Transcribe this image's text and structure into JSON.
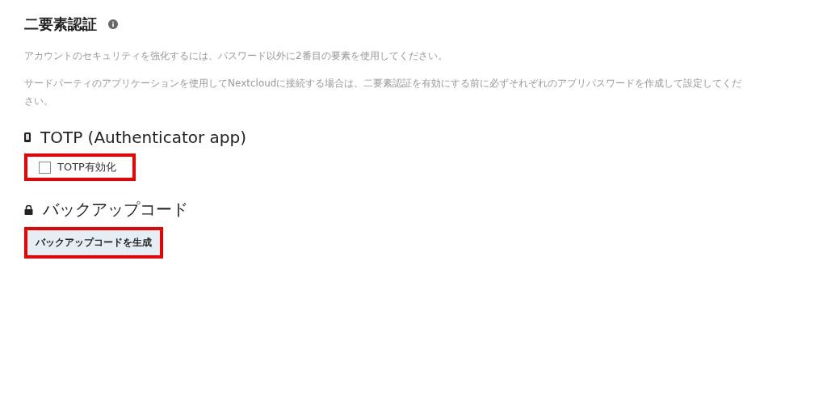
{
  "title": "二要素認証",
  "paragraphs": [
    "アカウントのセキュリティを強化するには、パスワード以外に2番目の要素を使用してください。",
    "サードパーティのアプリケーションを使用してNextcloudに接続する場合は、二要素認証を有効にする前に必ずそれぞれのアプリパスワードを作成して設定してください。"
  ],
  "sections": [
    {
      "kind": "checkbox",
      "heading": "TOTP (Authenticator app)",
      "label": "TOTP有効化",
      "checked": false,
      "highlighted": true
    },
    {
      "kind": "button",
      "heading": "バックアップコード",
      "label": "バックアップコードを生成",
      "highlighted": true
    }
  ]
}
